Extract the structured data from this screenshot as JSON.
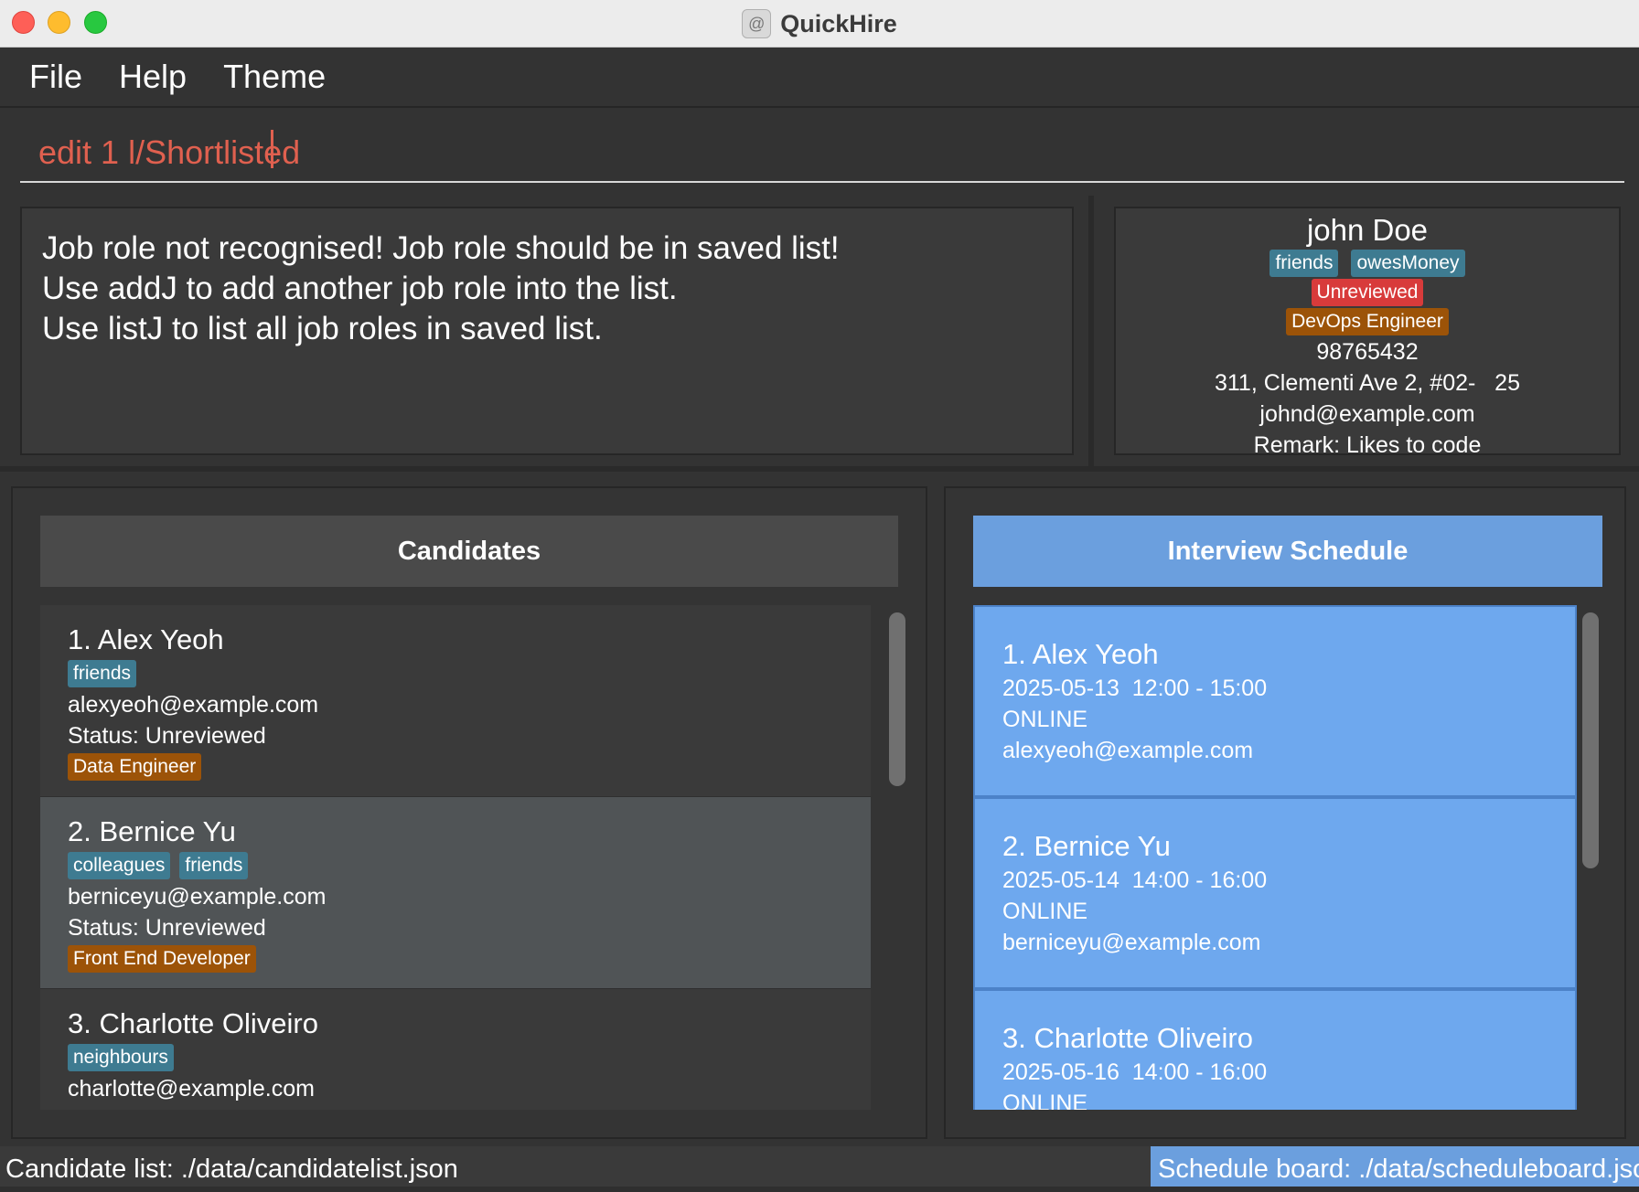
{
  "window": {
    "title": "QuickHire"
  },
  "menu": {
    "file": "File",
    "help": "Help",
    "theme": "Theme"
  },
  "command": {
    "value": "edit 1 l/Shortlisted"
  },
  "result": {
    "lines": [
      "Job role not recognised! Job role should be in saved list!",
      "Use addJ to add another job role into the list.",
      "Use listJ to list all job roles in saved list."
    ]
  },
  "detail": {
    "name": "john Doe",
    "tags": [
      "friends",
      "owesMoney"
    ],
    "status": "Unreviewed",
    "job_role": "DevOps Engineer",
    "phone": "98765432",
    "address": "311, Clementi Ave 2, #02-   25",
    "email": "johnd@example.com",
    "remark": "Remark: Likes to code"
  },
  "candidates": {
    "header": "Candidates",
    "items": [
      {
        "name": "1. Alex Yeoh",
        "tags": [
          "friends"
        ],
        "email": "alexyeoh@example.com",
        "status": "Status: Unreviewed",
        "job_role": "Data Engineer"
      },
      {
        "name": "2. Bernice Yu",
        "tags": [
          "colleagues",
          "friends"
        ],
        "email": "berniceyu@example.com",
        "status": "Status: Unreviewed",
        "job_role": "Front End Developer"
      },
      {
        "name": "3. Charlotte Oliveiro",
        "tags": [
          "neighbours"
        ],
        "email": "charlotte@example.com"
      }
    ]
  },
  "schedule": {
    "header": "Interview Schedule",
    "items": [
      {
        "name": "1. Alex Yeoh",
        "time": "2025-05-13  12:00 - 15:00",
        "mode": "ONLINE",
        "email": "alexyeoh@example.com"
      },
      {
        "name": "2. Bernice Yu",
        "time": "2025-05-14  14:00 - 16:00",
        "mode": "ONLINE",
        "email": "berniceyu@example.com"
      },
      {
        "name": "3. Charlotte Oliveiro",
        "time": "2025-05-16  14:00 - 16:00",
        "mode": "ONLINE"
      }
    ]
  },
  "status_bar": {
    "left": "Candidate list: ./data/candidatelist.json",
    "right": "Schedule board: ./data/scheduleboard.json"
  },
  "colors": {
    "accent": "#6b9fde",
    "command_text": "#e0604f",
    "tag_blue": "#3e7b91",
    "tag_red": "#d83b3b",
    "tag_orange": "#9c5308"
  }
}
